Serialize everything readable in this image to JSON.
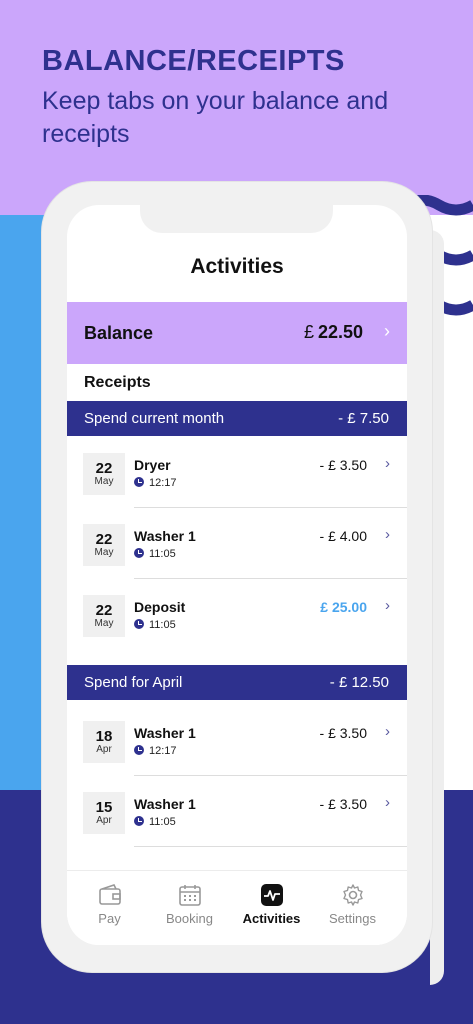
{
  "hero": {
    "title": "BALANCE/RECEIPTS",
    "subtitle": "Keep tabs on your balance and receipts"
  },
  "colors": {
    "lavender": "#cba6fb",
    "navy": "#2e318e",
    "blue": "#4aa5ee"
  },
  "app": {
    "title": "Activities",
    "balance": {
      "label": "Balance",
      "currency": "£",
      "amount": "22.50"
    },
    "receipts_label": "Receipts",
    "sections": [
      {
        "label": "Spend current month",
        "total": "- £ 7.50",
        "items": [
          {
            "day": "22",
            "month": "May",
            "name": "Dryer",
            "time": "12:17",
            "amount": "- £ 3.50"
          },
          {
            "day": "22",
            "month": "May",
            "name": "Washer 1",
            "time": "11:05",
            "amount": "- £ 4.00"
          },
          {
            "day": "22",
            "month": "May",
            "name": "Deposit",
            "time": "11:05",
            "amount": "£ 25.00"
          }
        ]
      },
      {
        "label": "Spend for April",
        "total": "- £ 12.50",
        "items": [
          {
            "day": "18",
            "month": "Apr",
            "name": "Washer 1",
            "time": "12:17",
            "amount": "- £ 3.50"
          },
          {
            "day": "15",
            "month": "Apr",
            "name": "Washer 1",
            "time": "11:05",
            "amount": "- £ 3.50"
          }
        ]
      }
    ],
    "tabs": [
      {
        "label": "Pay",
        "icon": "wallet-icon"
      },
      {
        "label": "Booking",
        "icon": "calendar-icon"
      },
      {
        "label": "Activities",
        "icon": "activity-icon"
      },
      {
        "label": "Settings",
        "icon": "gear-icon"
      }
    ]
  }
}
